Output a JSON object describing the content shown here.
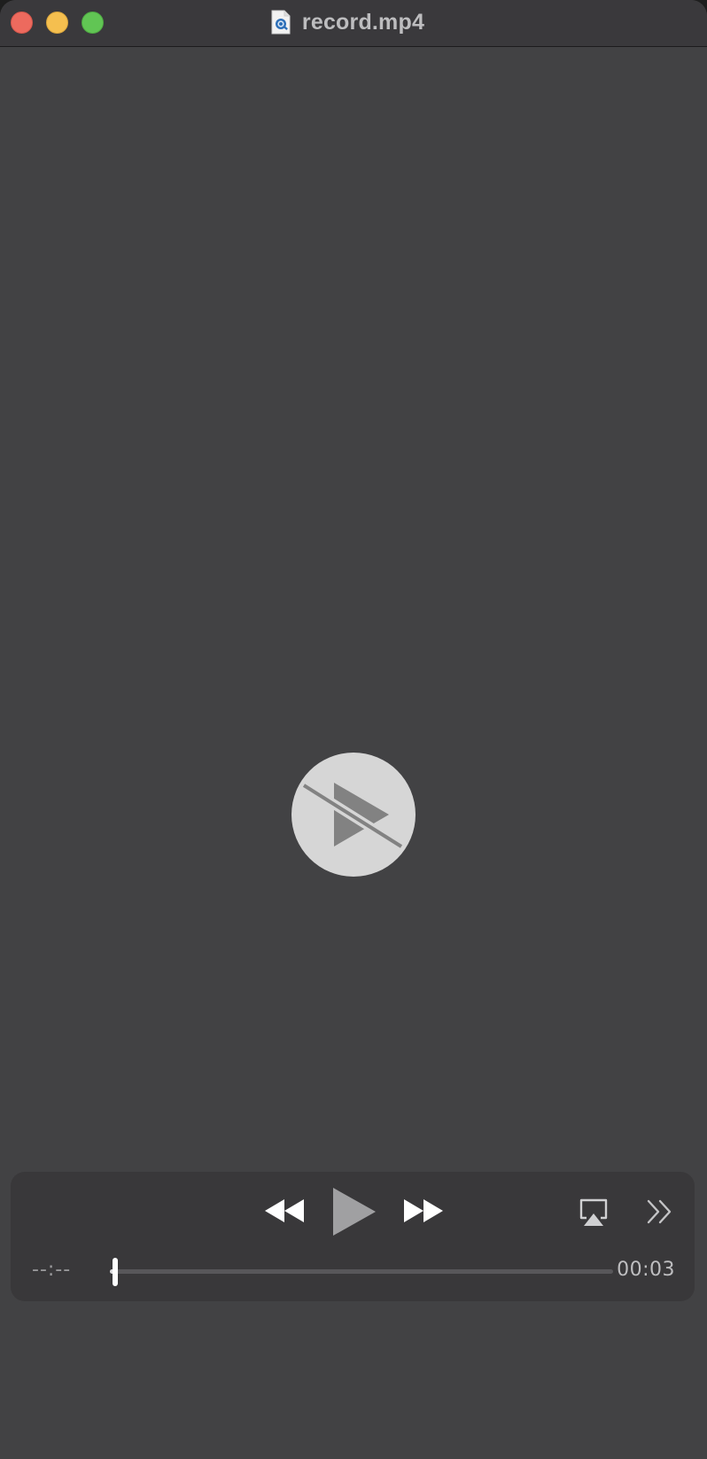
{
  "window": {
    "title": "record.mp4"
  },
  "player": {
    "elapsed_time": "--:--",
    "total_time": "00:03",
    "progress": 0.01,
    "status_icon": "play-disabled-icon"
  },
  "controls": {
    "icons": [
      "rewind-icon",
      "play-icon",
      "fast-forward-icon",
      "airplay-icon",
      "more-icon"
    ]
  },
  "colors": {
    "close": "#ed6a5e",
    "minimize": "#f5bf4f",
    "zoom": "#61c554",
    "video_background": "#424244",
    "control_bar": "#39383a"
  }
}
